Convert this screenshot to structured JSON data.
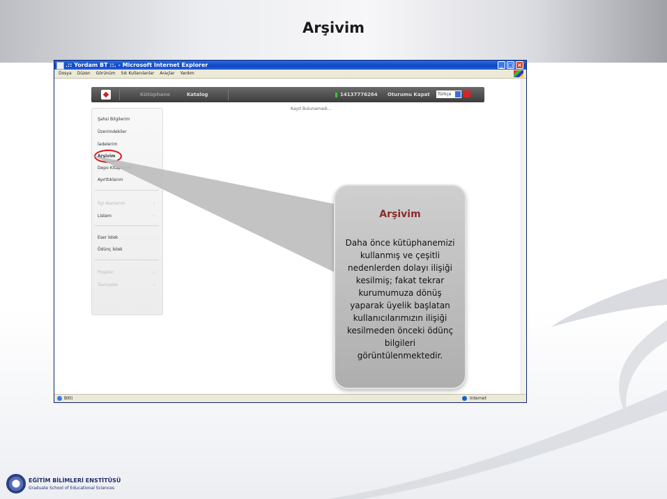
{
  "slide": {
    "title": "Arşivim",
    "footer": {
      "institute": "EĞİTİM BİLİMLERİ ENSTİTÜSÜ",
      "subtitle": "Graduate School of Educational Sciences"
    }
  },
  "browser": {
    "window_title": ".:: Yordam BT ::.  - Microsoft Internet Explorer",
    "menu": [
      "Dosya",
      "Düzen",
      "Görünüm",
      "Sık Kullanılanlar",
      "Araçlar",
      "Yardım"
    ],
    "status_left": "Bitti",
    "status_right": "Internet"
  },
  "navbar": {
    "items": [
      "Kütüphane",
      "Katalog"
    ],
    "user_id": "14137776264",
    "logout": "Oturumu Kapat",
    "language": "Türkçe"
  },
  "sidebar": {
    "group1": [
      "Şahsi Bilgilerim",
      "Üzerimdekiler",
      "İadelerim",
      "Arşivim",
      "Depo Kitaplarım",
      "Ayırttıklarım"
    ],
    "group2": [
      "İlgi Alanlarım",
      "Listem"
    ],
    "group3": [
      "Eser İstek",
      "Ödünç İstek"
    ],
    "group4": [
      "Projeler",
      "Tavsiyeler"
    ]
  },
  "content": {
    "no_record": "Kayıt Bulunamadı..."
  },
  "callout": {
    "title": "Arşivim",
    "lines": [
      "Daha önce kütüphanemizi",
      "kullanmış ve çeşitli",
      "nedenlerden dolayı ilişiği",
      "kesilmiş; fakat tekrar",
      "kurumumuza dönüş",
      "yaparak üyelik başlatan",
      "kullanıcılarımızın ilişiği",
      "kesilmeden önceki  ödünç",
      "bilgileri",
      "görüntülenmektedir."
    ]
  },
  "colors": {
    "accent": "#d8141a",
    "callout_title": "#8b2a2a",
    "titlebar": "#0d47c4"
  }
}
